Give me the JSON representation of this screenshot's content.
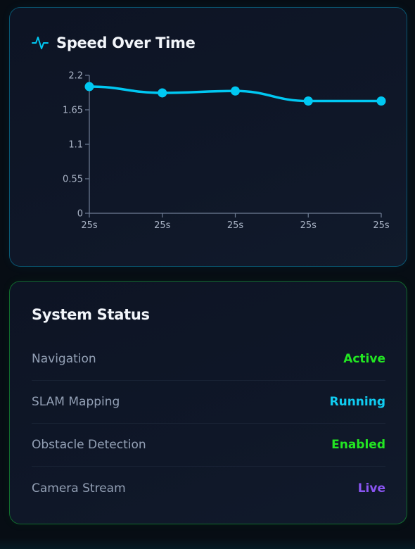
{
  "speed_card": {
    "title": "Speed Over Time",
    "icon": "pulse-icon",
    "accent_color": "#00c8f2"
  },
  "chart_data": {
    "type": "line",
    "title": "Speed Over Time",
    "x": [
      "25s",
      "25s",
      "25s",
      "25s",
      "25s"
    ],
    "series": [
      {
        "values": [
          2.02,
          1.92,
          1.95,
          1.79,
          1.79
        ]
      }
    ],
    "ylim": [
      0,
      2.2
    ],
    "yticks": [
      0,
      0.55,
      1.1,
      1.65,
      2.2
    ],
    "ytick_labels": [
      "0",
      "0.55",
      "1.1",
      "1.65",
      "2.2"
    ],
    "grid": false,
    "line_color": "#00c8f2"
  },
  "status_card": {
    "title": "System Status",
    "items": [
      {
        "label": "Navigation",
        "value": "Active",
        "color": "#22e622"
      },
      {
        "label": "SLAM Mapping",
        "value": "Running",
        "color": "#10cdf2"
      },
      {
        "label": "Obstacle Detection",
        "value": "Enabled",
        "color": "#22e622"
      },
      {
        "label": "Camera Stream",
        "value": "Live",
        "color": "#8a55f2"
      }
    ]
  }
}
